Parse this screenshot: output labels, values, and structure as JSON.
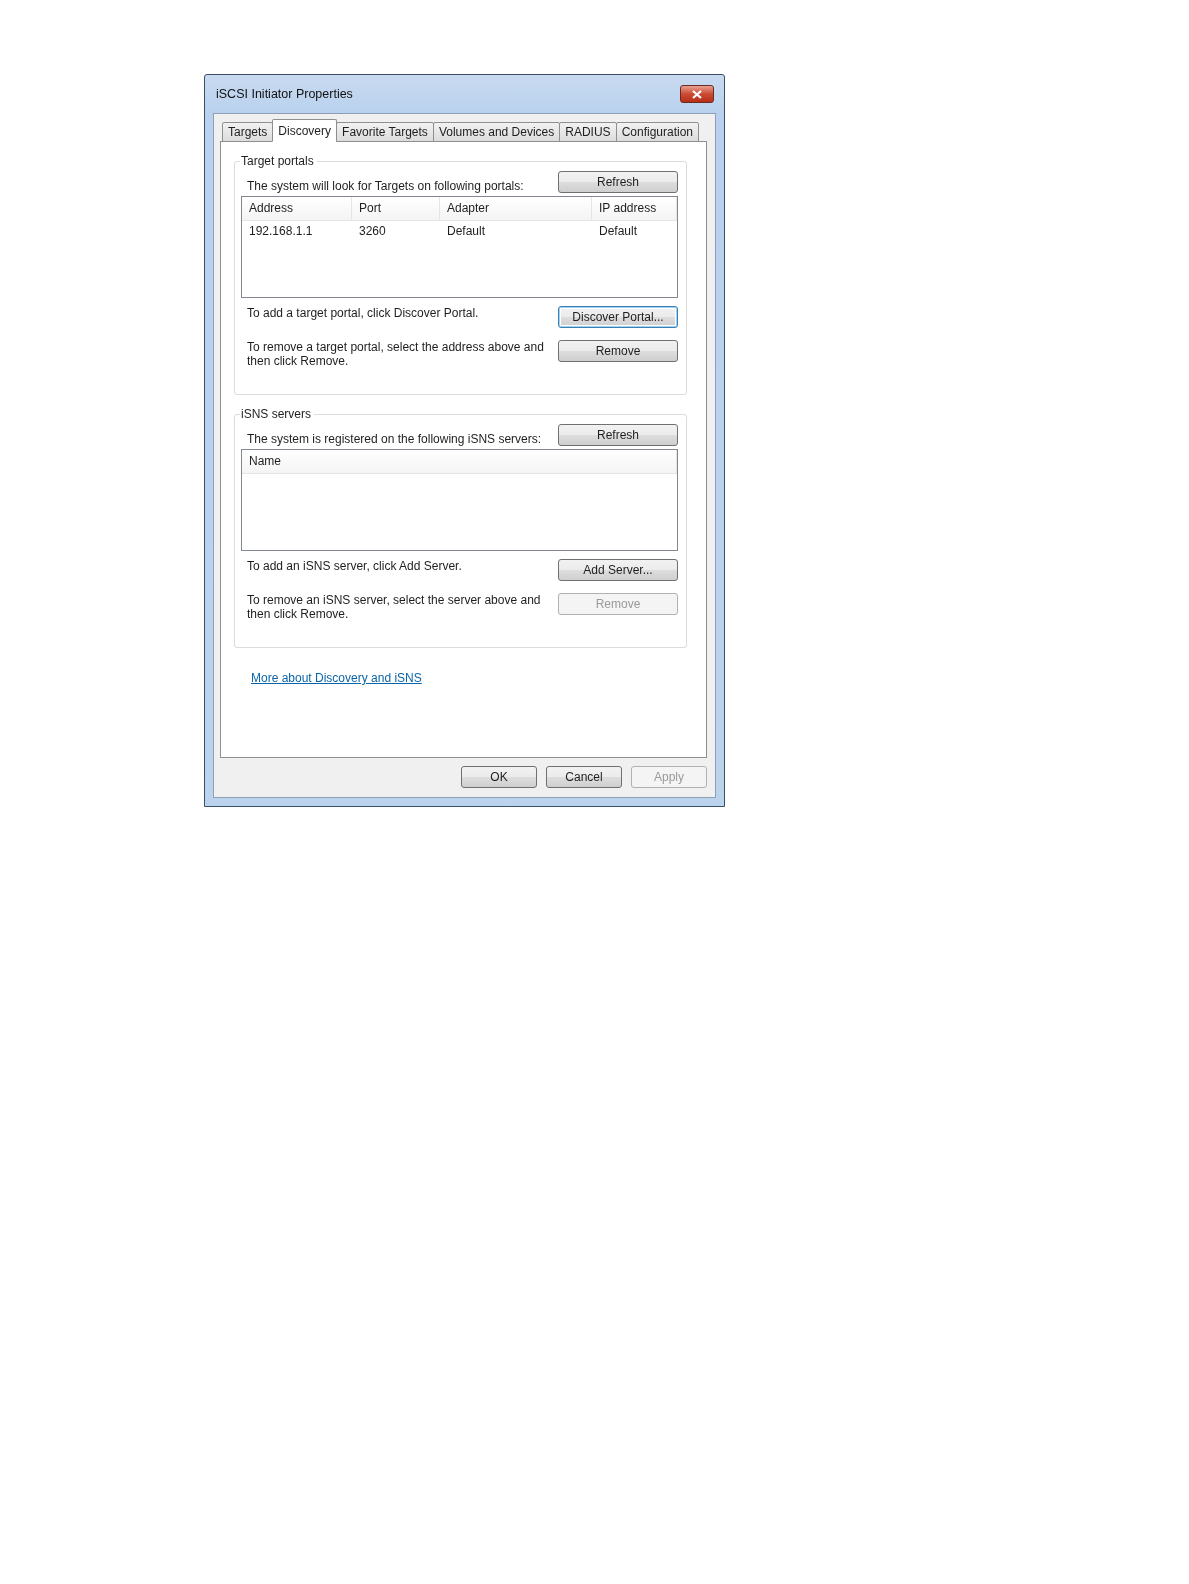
{
  "window": {
    "title": "iSCSI Initiator Properties"
  },
  "tabs": [
    {
      "label": "Targets",
      "selected": false
    },
    {
      "label": "Discovery",
      "selected": true
    },
    {
      "label": "Favorite Targets",
      "selected": false
    },
    {
      "label": "Volumes and Devices",
      "selected": false
    },
    {
      "label": "RADIUS",
      "selected": false
    },
    {
      "label": "Configuration",
      "selected": false
    }
  ],
  "groups": [
    {
      "title": "Target portals",
      "caption": "The system will look for Targets on following portals:",
      "refresh": {
        "label": "Refresh",
        "disabled": false,
        "focused": false
      },
      "columns": [
        "Address",
        "Port",
        "Adapter",
        "IP address"
      ],
      "rows": [
        [
          "192.168.1.1",
          "3260",
          "Default",
          "Default"
        ]
      ],
      "actions": [
        {
          "text": "To add a target portal, click Discover Portal.",
          "button": {
            "label": "Discover Portal...",
            "disabled": false,
            "focused": true
          }
        },
        {
          "text": "To remove a target portal, select the address above and then click Remove.",
          "button": {
            "label": "Remove",
            "disabled": false,
            "focused": false
          }
        }
      ]
    },
    {
      "title": "iSNS servers",
      "caption": "The system is registered on the following iSNS servers:",
      "refresh": {
        "label": "Refresh",
        "disabled": false,
        "focused": false
      },
      "columns": [
        "Name"
      ],
      "actions": [
        {
          "text": "To add an iSNS server, click Add Server.",
          "button": {
            "label": "Add Server...",
            "disabled": false,
            "focused": false
          }
        },
        {
          "text": "To remove an iSNS server, select the server above and then click Remove.",
          "button": {
            "label": "Remove",
            "disabled": true,
            "focused": false
          }
        }
      ]
    }
  ],
  "link": "More about Discovery and iSNS",
  "buttons": [
    {
      "label": "OK",
      "disabled": false
    },
    {
      "label": "Cancel",
      "disabled": false
    },
    {
      "label": "Apply",
      "disabled": true
    }
  ]
}
